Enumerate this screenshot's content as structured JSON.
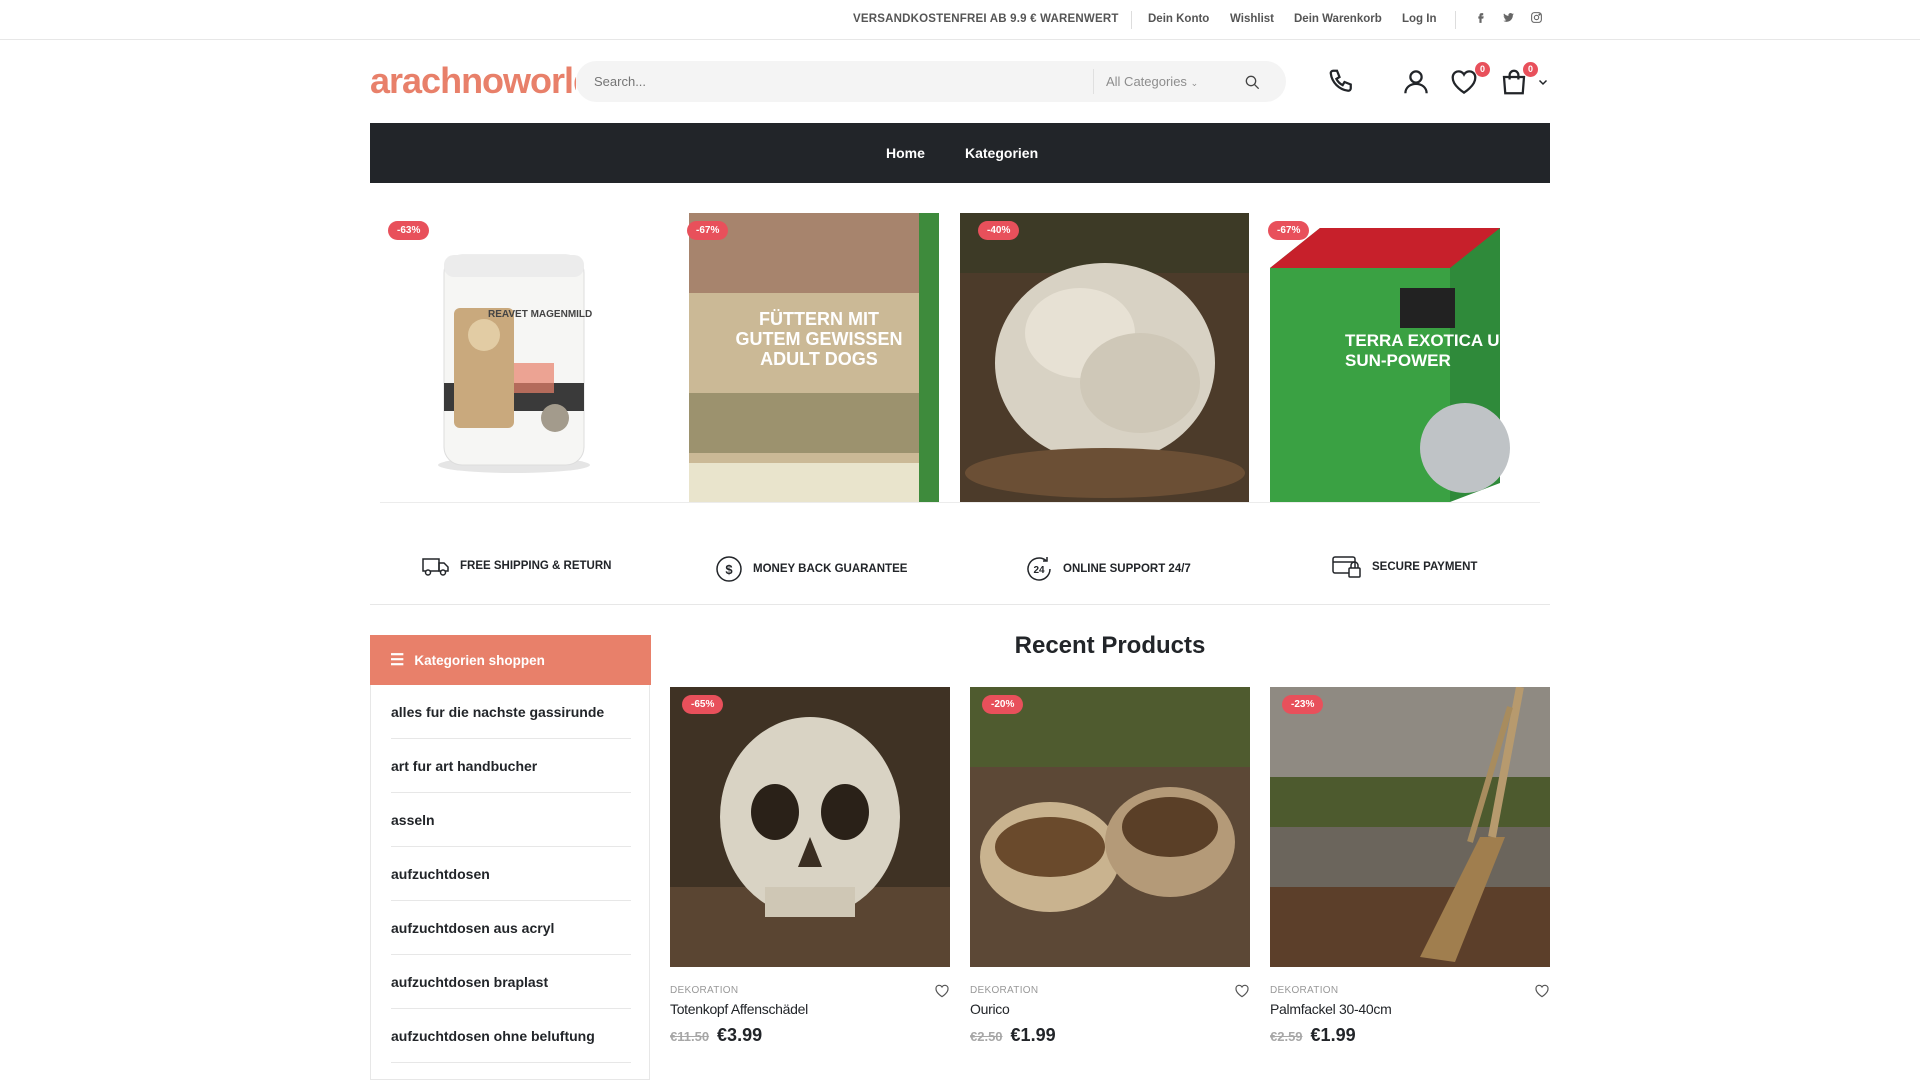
{
  "topbar": {
    "promo": "VERSANDKOSTENFREI AB 9.9 € WARENWERT",
    "links": [
      "Dein Konto",
      "Wishlist",
      "Dein Warenkorb",
      "Log In"
    ],
    "social": [
      "facebook-icon",
      "twitter-icon",
      "instagram-icon"
    ]
  },
  "header": {
    "logo": "arachnoworld",
    "search_placeholder": "Search...",
    "category_select": "All Categories",
    "wishlist_count": "0",
    "cart_count": "0"
  },
  "nav": {
    "items": [
      "Home",
      "Kategorien"
    ]
  },
  "slider": {
    "items": [
      {
        "discount": "-63%",
        "label": "REAVET MAGENMILD"
      },
      {
        "discount": "-67%",
        "label": "FÜTTERN MIT GUTEM GEWISSEN ADULT DOGS"
      },
      {
        "discount": "-40%",
        "label": ""
      },
      {
        "discount": "-67%",
        "label": "TERRA EXOTICA UV SUN-POWER"
      }
    ]
  },
  "features": [
    {
      "label": "FREE SHIPPING & RETURN",
      "icon": "truck-icon"
    },
    {
      "label": "MONEY BACK GUARANTEE",
      "icon": "dollar-icon"
    },
    {
      "label": "ONLINE SUPPORT 24/7",
      "icon": "support-24-icon"
    },
    {
      "label": "SECURE PAYMENT",
      "icon": "secure-payment-icon"
    }
  ],
  "sidebar": {
    "title": "Kategorien shoppen",
    "items": [
      "alles fur die nachste gassirunde",
      "art fur art handbucher",
      "asseln",
      "aufzuchtdosen",
      "aufzuchtdosen aus acryl",
      "aufzuchtdosen braplast",
      "aufzuchtdosen ohne beluftung"
    ]
  },
  "recent": {
    "title": "Recent Products",
    "products": [
      {
        "discount": "-65%",
        "category": "DEKORATION",
        "name": "Totenkopf Affenschädel",
        "old_price": "€11.50",
        "price": "€3.99"
      },
      {
        "discount": "-20%",
        "category": "DEKORATION",
        "name": "Ourico",
        "old_price": "€2.50",
        "price": "€1.99"
      },
      {
        "discount": "-23%",
        "category": "DEKORATION",
        "name": "Palmfackel 30-40cm",
        "old_price": "€2.59",
        "price": "€1.99"
      }
    ]
  },
  "colors": {
    "accent": "#e8806a",
    "badge": "#e8505b",
    "dark": "#222529"
  }
}
